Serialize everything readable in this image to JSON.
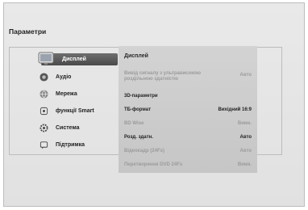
{
  "page": {
    "title": "Параметри"
  },
  "sidebar": {
    "items": [
      {
        "label": "Дисплей",
        "icon": "display-icon",
        "selected": true
      },
      {
        "label": "Аудіо",
        "icon": "audio-icon"
      },
      {
        "label": "Мережа",
        "icon": "network-icon"
      },
      {
        "label": "функції Smart",
        "icon": "smart-icon"
      },
      {
        "label": "Система",
        "icon": "system-gear-icon"
      },
      {
        "label": "Підтримка",
        "icon": "support-icon"
      }
    ]
  },
  "panel": {
    "title": "Дисплей",
    "rows": [
      {
        "label": "Вивід сигналу з ультрависокою роздільною здатністю",
        "value": "Авто",
        "enabled": false
      },
      {
        "label": "3D-параметри",
        "value": "",
        "enabled": true
      },
      {
        "label": "ТБ-формат",
        "value": "Вихідний 16:9",
        "enabled": true
      },
      {
        "label": "BD Wise",
        "value": "Вимк.",
        "enabled": false
      },
      {
        "label": "Розд. здатн.",
        "value": "Авто",
        "enabled": true
      },
      {
        "label": "Відеокадр (24Fs)",
        "value": "Авто",
        "enabled": false
      },
      {
        "label": "Перетворення DVD 24Fs",
        "value": "Вимк.",
        "enabled": false
      }
    ]
  },
  "colors": {
    "selected_bg": "#5a5a5a",
    "panel_bg": "#cccccc",
    "disabled_text": "#9b9b9b"
  }
}
